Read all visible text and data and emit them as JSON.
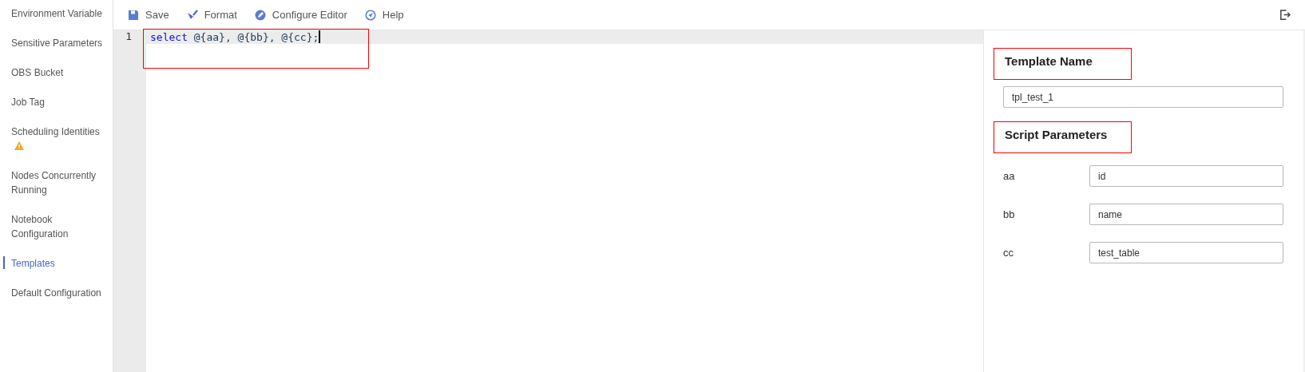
{
  "sidebar": {
    "items": [
      {
        "label": "Environment Variable",
        "selected": false,
        "warning": false
      },
      {
        "label": "Sensitive Parameters",
        "selected": false,
        "warning": false
      },
      {
        "label": "OBS Bucket",
        "selected": false,
        "warning": false
      },
      {
        "label": "Job Tag",
        "selected": false,
        "warning": false
      },
      {
        "label": "Scheduling Identities",
        "selected": false,
        "warning": true
      },
      {
        "label": "Nodes Concurrently Running",
        "selected": false,
        "warning": false
      },
      {
        "label": "Notebook Configuration",
        "selected": false,
        "warning": false
      },
      {
        "label": "Templates",
        "selected": true,
        "warning": false
      },
      {
        "label": "Default Configuration",
        "selected": false,
        "warning": false
      }
    ]
  },
  "toolbar": {
    "buttons": [
      {
        "label": "Save",
        "kind": "save"
      },
      {
        "label": "Format",
        "kind": "format"
      },
      {
        "label": "Configure Editor",
        "kind": "configure"
      },
      {
        "label": "Help",
        "kind": "help"
      }
    ]
  },
  "editor": {
    "lines": [
      {
        "number": "1",
        "tokens": [
          {
            "text": "select",
            "kind": "keyword"
          },
          {
            "text": " @{aa}, @{bb}, @{cc};",
            "kind": "plain"
          }
        ]
      }
    ]
  },
  "panel": {
    "template_name": {
      "heading": "Template Name",
      "value": "tpl_test_1"
    },
    "script_parameters": {
      "heading": "Script Parameters",
      "params": [
        {
          "name": "aa",
          "value": "id"
        },
        {
          "name": "bb",
          "value": "name"
        },
        {
          "name": "cc",
          "value": "test_table"
        }
      ]
    }
  }
}
